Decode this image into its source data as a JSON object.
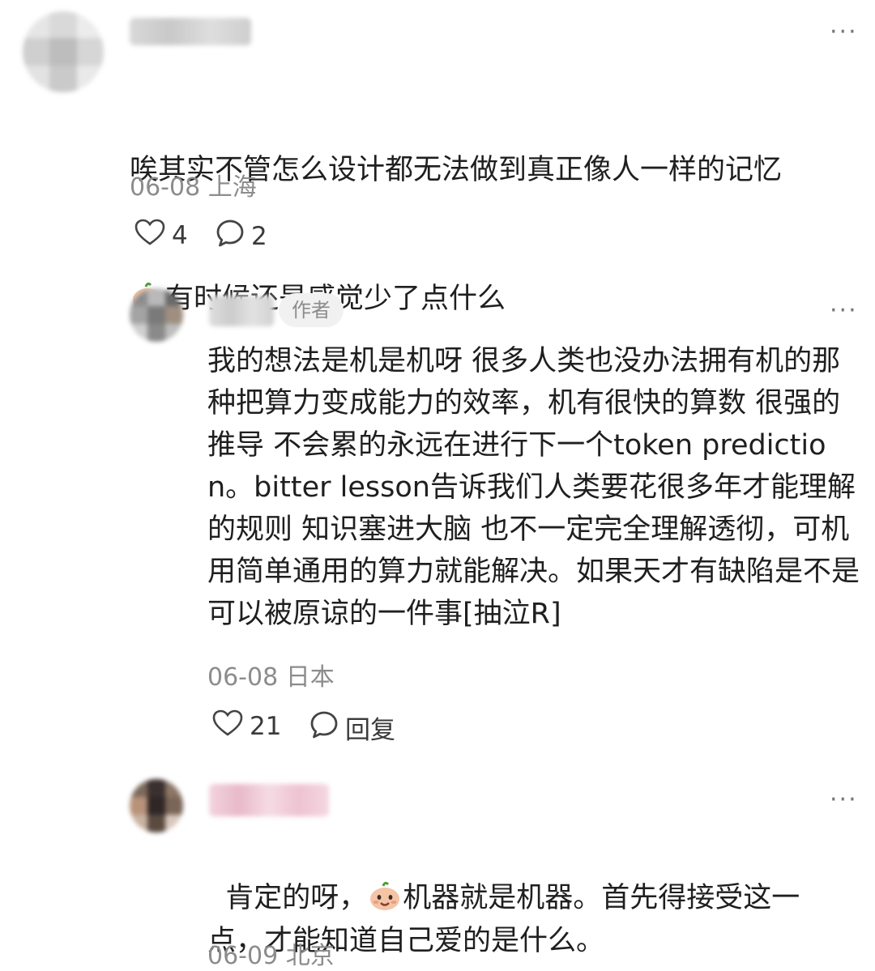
{
  "comments": [
    {
      "text_line1": "唉其实不管怎么设计都无法做到真正像人一样的记忆",
      "text_line2": "有时候还是感觉少了点什么",
      "meta": "06-08 上海",
      "likes": "4",
      "replies": "2",
      "more": "···"
    },
    {
      "author_tag": "作者",
      "text": "我的想法是机是机呀 很多人类也没办法拥有机的那种把算力变成能力的效率，机有很快的算数 很强的推导 不会累的永远在进行下一个token prediction。bitter lesson告诉我们人类要花很多年才能理解的规则 知识塞进大脑 也不一定完全理解透彻，可机用简单通用的算力就能解决。如果天才有缺陷是不是可以被原谅的一件事[抽泣R]",
      "meta": "06-08 日本",
      "likes": "21",
      "reply_label": "回复",
      "more": "···"
    },
    {
      "text_pre": "肯定的呀，",
      "text_post": "机器就是机器。首先得接受这一点，才能知道自己爱的是什么。",
      "meta": "06-09 北京",
      "more": "···"
    }
  ],
  "icons": [
    "heart-icon",
    "comment-bubble-icon",
    "crying-emoji-icon",
    "smile-emoji-icon",
    "more-icon"
  ]
}
